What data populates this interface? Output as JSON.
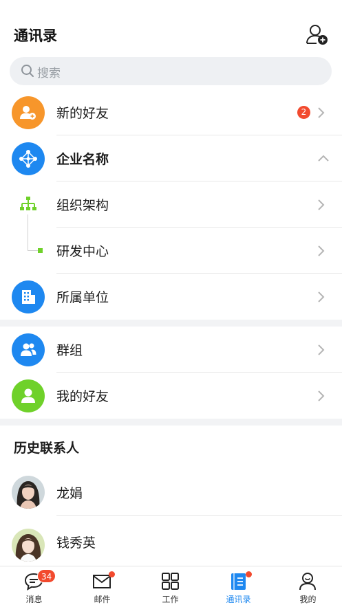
{
  "header": {
    "title": "通讯录"
  },
  "search": {
    "placeholder": "搜索"
  },
  "rows": {
    "new_friends": {
      "label": "新的好友",
      "badge": "2"
    },
    "company": {
      "label": "企业名称"
    },
    "org": {
      "label": "组织架构"
    },
    "rd": {
      "label": "研发中心"
    },
    "unit": {
      "label": "所属单位"
    },
    "groups": {
      "label": "群组"
    },
    "my_friends": {
      "label": "我的好友"
    }
  },
  "history": {
    "title": "历史联系人",
    "contacts": [
      {
        "name": "龙娟"
      },
      {
        "name": "钱秀英"
      }
    ]
  },
  "tabbar": {
    "tabs": [
      {
        "label": "消息",
        "badge": "34"
      },
      {
        "label": "邮件"
      },
      {
        "label": "工作"
      },
      {
        "label": "通讯录"
      },
      {
        "label": "我的"
      }
    ]
  },
  "colors": {
    "accent": "#1e88f0",
    "orange": "#f7962b",
    "green": "#6fd12a",
    "badge": "#f24a2e"
  }
}
